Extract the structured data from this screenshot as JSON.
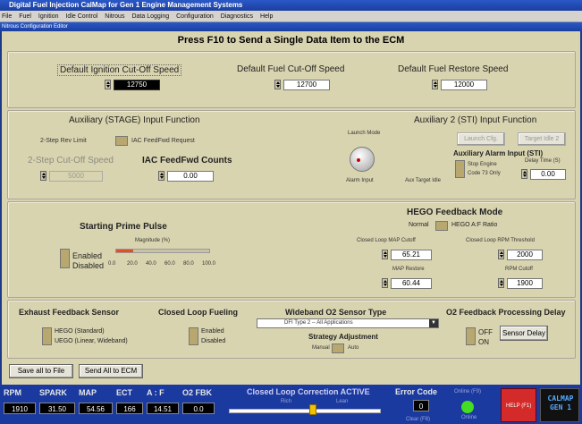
{
  "window": {
    "title": "Digital Fuel Injection CalMap for Gen 1 Engine Management Systems",
    "menu": [
      "File",
      "Fuel",
      "Ignition",
      "Idle Control",
      "Nitrous",
      "Data Logging",
      "Configuration",
      "Diagnostics",
      "Help"
    ],
    "subtitle": "Nitrous Configuration Editor"
  },
  "banner": "Press F10 to Send a Single Data Item to the ECM",
  "defaults": {
    "ignition_cutoff_label": "Default Ignition Cut-Off Speed",
    "ignition_cutoff_value": "12750",
    "fuel_cutoff_label": "Default Fuel Cut-Off Speed",
    "fuel_cutoff_value": "12700",
    "fuel_restore_label": "Default Fuel Restore Speed",
    "fuel_restore_value": "12000"
  },
  "aux_stage": {
    "title": "Auxiliary (STAGE) Input Function",
    "two_step_label": "2-Step Rev Limit",
    "iac_req_label": "IAC FeedFwd Request",
    "cutoff_label": "2-Step Cut-Off Speed",
    "cutoff_value": "5000",
    "iac_counts_label": "IAC FeedFwd Counts",
    "iac_counts_value": "0.00"
  },
  "aux_sti": {
    "title": "Auxiliary 2 (STI) Input Function",
    "launch_mode": "Launch Mode",
    "alarm_input": "Alarm Input",
    "aux_target_idle": "Aux Target Idle",
    "launch_cfg_btn": "Launch Cfg.",
    "target_idle_btn": "Target Idle 2",
    "alarm_title": "Auxiliary Alarm Input (STI)",
    "stop_engine": "Stop Engine",
    "code_73": "Code 73 Only",
    "delay_label": "Delay Time (S)",
    "delay_value": "0.00"
  },
  "prime": {
    "title": "Starting Prime Pulse",
    "magnitude_label": "Magnitude (%)",
    "enabled": "Enabled",
    "disabled": "Disabled",
    "ticks": [
      "0.0",
      "20.0",
      "40.0",
      "60.0",
      "80.0",
      "100.0"
    ],
    "level_fraction": 0.18
  },
  "hego": {
    "title": "HEGO Feedback Mode",
    "normal": "Normal",
    "afr": "HEGO A:F Ratio",
    "map_cutoff_label": "Closed Loop MAP Cutoff",
    "map_cutoff_value": "65.21",
    "rpm_threshold_label": "Closed Loop RPM Threshold",
    "rpm_threshold_value": "2000",
    "map_restore_label": "MAP Restore",
    "map_restore_value": "60.44",
    "rpm_cutoff_label": "RPM Cutoff",
    "rpm_cutoff_value": "1900"
  },
  "exhaust": {
    "title": "Exhaust Feedback Sensor",
    "hego": "HEGO (Standard)",
    "uego": "UEGO (Linear, Wideband)"
  },
  "closed_loop": {
    "title": "Closed Loop Fueling",
    "enabled": "Enabled",
    "disabled": "Disabled"
  },
  "wideband": {
    "title": "Wideband O2 Sensor Type",
    "selected": "DFI Type 2 -- All Applications",
    "strategy_title": "Strategy Adjustment",
    "manual": "Manual",
    "auto": "Auto"
  },
  "o2_delay": {
    "title": "O2 Feedback Processing Delay",
    "off": "OFF",
    "on": "ON",
    "button": "Sensor Delay"
  },
  "actions": {
    "save": "Save all to File",
    "send": "Send All to ECM"
  },
  "status": {
    "headers": [
      "RPM",
      "SPARK",
      "MAP",
      "ECT",
      "A : F",
      "O2 FBK"
    ],
    "values": [
      "1910",
      "31.50",
      "54.56",
      "166",
      "14.51",
      "0.0"
    ],
    "closed_loop_msg": "Closed Loop Correction ACTIVE",
    "rich": "Rich",
    "lean": "Lean",
    "error_code_label": "Error Code",
    "error_code_value": "0",
    "online_label": "Online (F9)",
    "online_sub": "Online",
    "clear_label": "Clear (F8)",
    "help_label": "HELP (F1)",
    "logo": "CALMAP GEN 1",
    "correction_fraction": 0.55,
    "colors": {
      "online": "#44dd22",
      "help": "#d42a2a"
    }
  }
}
